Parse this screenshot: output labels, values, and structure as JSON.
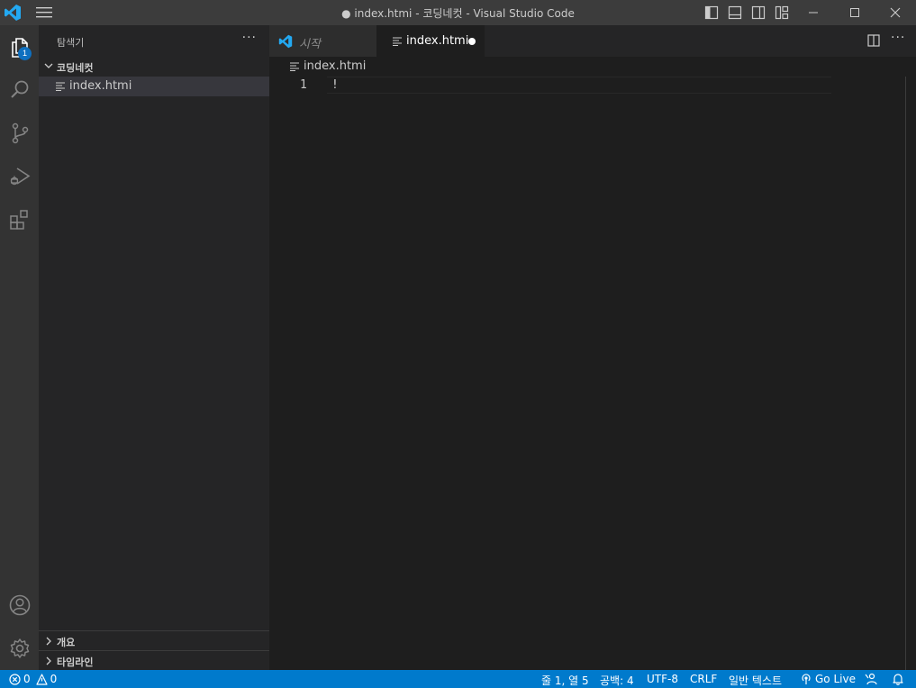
{
  "titlebar": {
    "title": "● index.htmi - 코딩네컷 - Visual Studio Code",
    "brand_color": "#23a9f2"
  },
  "activity": {
    "explorer_badge": "1",
    "items": [
      "files-icon",
      "search-icon",
      "source-control-icon",
      "run-debug-icon",
      "extensions-icon",
      "account-icon",
      "settings-gear-icon"
    ]
  },
  "sidebar": {
    "title": "탐색기",
    "more": "···",
    "folder": "코딩네컷",
    "file": "index.htmi",
    "outline": "개요",
    "timeline": "타임라인"
  },
  "editor": {
    "tabs": [
      {
        "label": "시작",
        "icon": "vscode-logo-icon"
      },
      {
        "label": "index.htmi",
        "icon": "file-icon",
        "dirty": true
      }
    ],
    "more": "···",
    "breadcrumb": "index.htmi",
    "line_number": "1",
    "code": "!"
  },
  "statusbar": {
    "errors": "0",
    "warnings": "0",
    "position": "줄 1, 열 5",
    "spaces": "공백: 4",
    "encoding": "UTF-8",
    "eol": "CRLF",
    "language": "일반 텍스트",
    "golive": "Go Live",
    "background": "#007acc"
  }
}
